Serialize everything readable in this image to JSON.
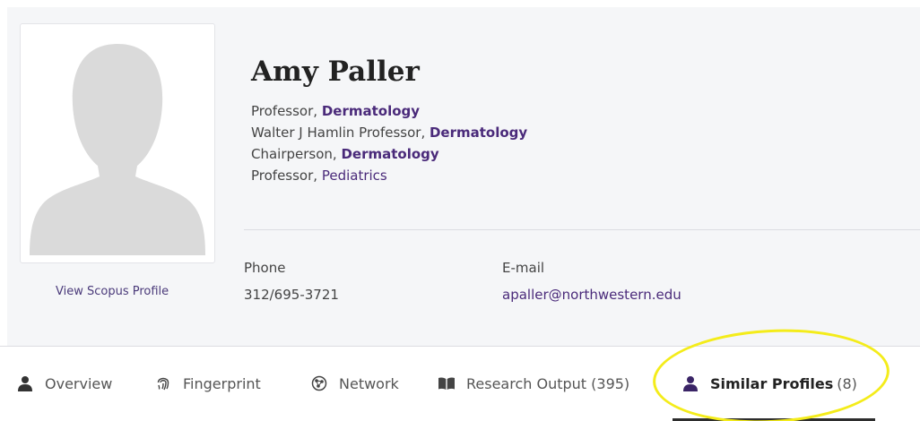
{
  "profile": {
    "name": "Amy Paller",
    "scopus_link": "View Scopus Profile",
    "roles": [
      {
        "title": "Professor, ",
        "dept": "Dermatology"
      },
      {
        "title": "Walter J Hamlin Professor, ",
        "dept": "Dermatology"
      },
      {
        "title": "Chairperson, ",
        "dept": "Dermatology"
      },
      {
        "title": "Professor, ",
        "dept": "Pediatrics"
      }
    ]
  },
  "contact": {
    "phone_label": "Phone",
    "phone": "312/695-3721",
    "email_label": "E-mail",
    "email": "apaller@northwestern.edu"
  },
  "tabs": {
    "overview": {
      "label": "Overview"
    },
    "fingerprint": {
      "label": "Fingerprint"
    },
    "network": {
      "label": "Network"
    },
    "research_output": {
      "label": "Research Output (395)"
    },
    "similar_profiles": {
      "label": "Similar Profiles",
      "count": "(8)"
    }
  },
  "colors": {
    "accent": "#4a2a7a",
    "panel_bg": "#f5f6f8",
    "highlight": "#f4ec1a"
  },
  "icons": {
    "overview": "person-icon",
    "fingerprint": "fingerprint-icon",
    "network": "network-globe-icon",
    "research_output": "open-book-icon",
    "similar_profiles": "person-icon"
  }
}
